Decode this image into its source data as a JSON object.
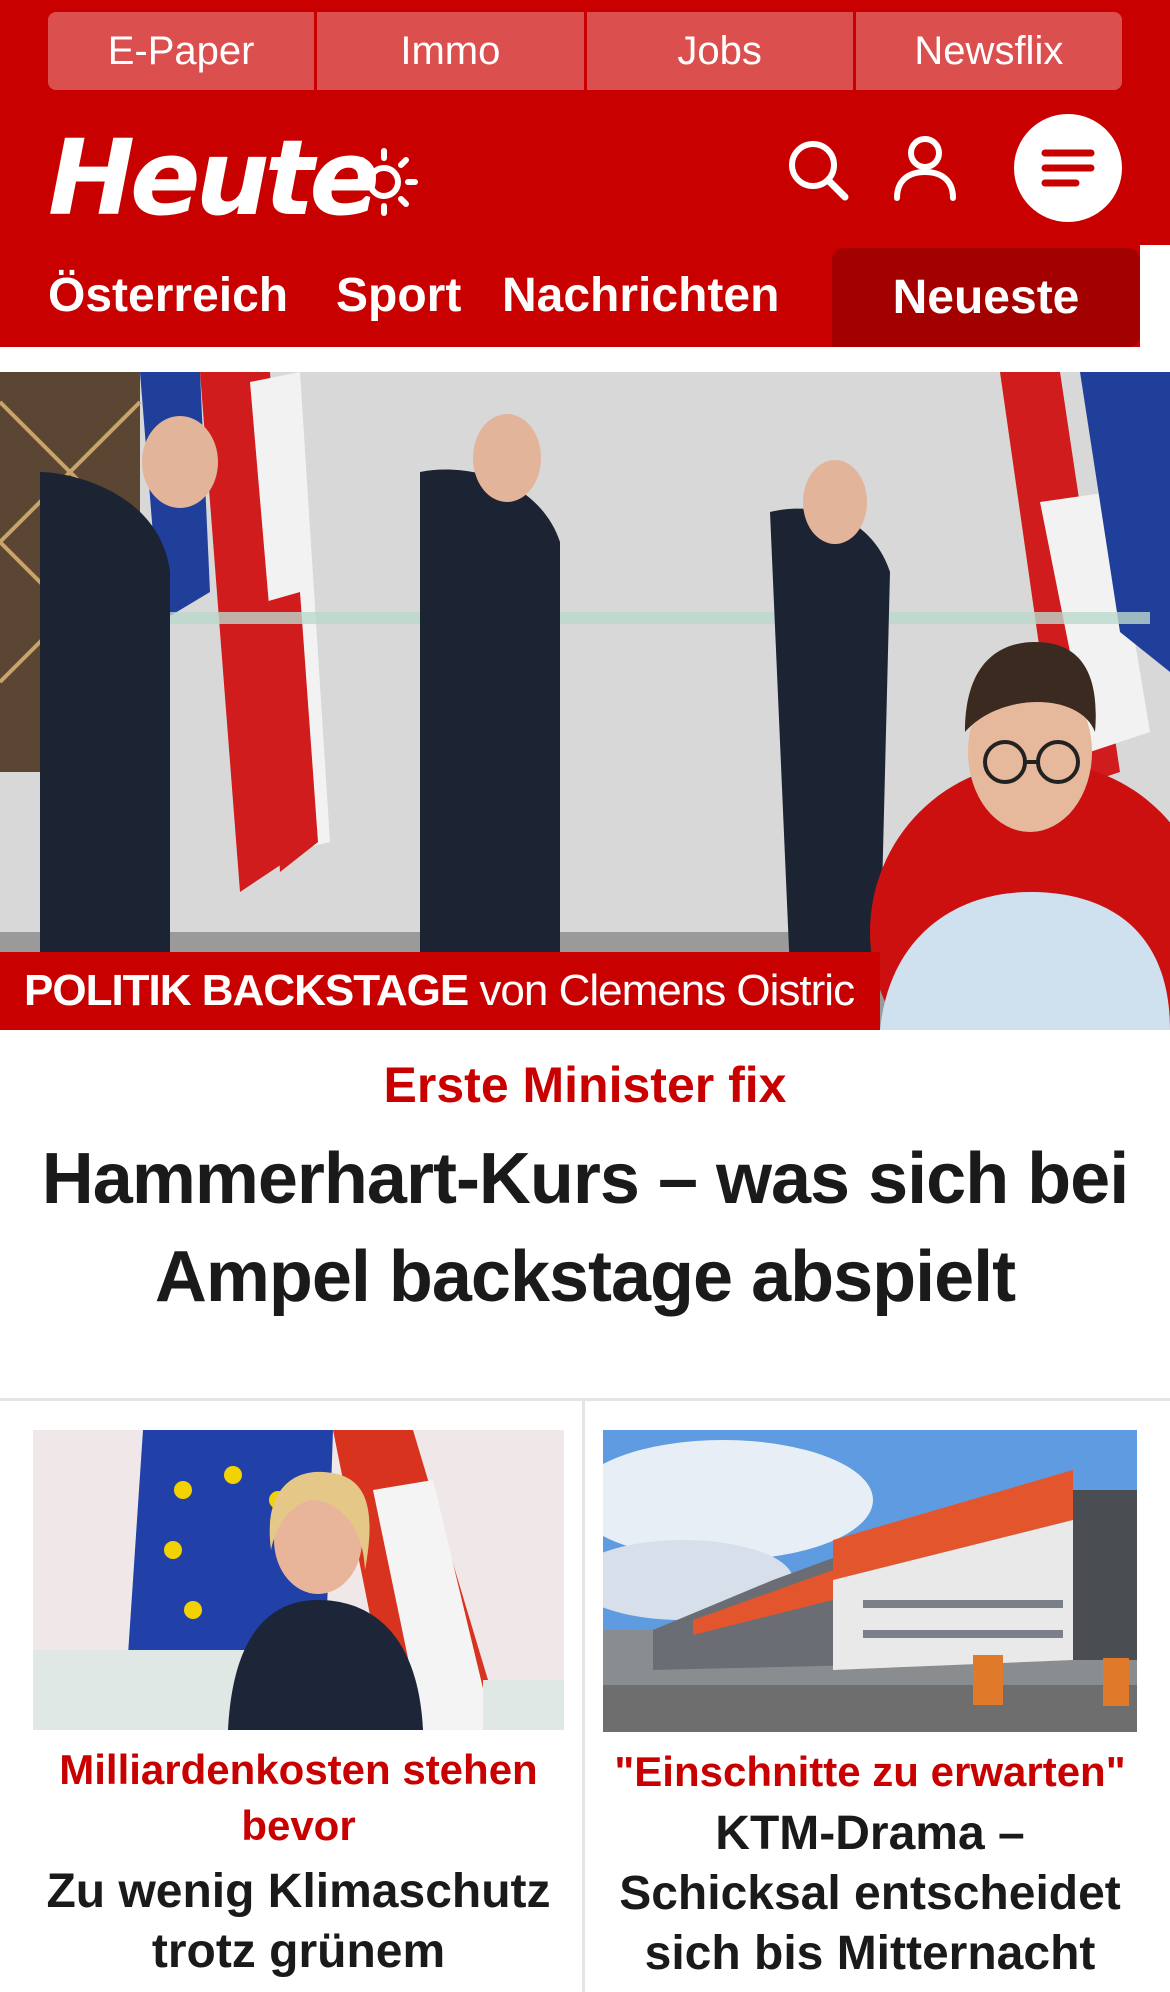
{
  "subnav": {
    "items": [
      {
        "label": "E-Paper"
      },
      {
        "label": "Immo"
      },
      {
        "label": "Jobs"
      },
      {
        "label": "Newsflix"
      }
    ]
  },
  "header": {
    "logo": "Heute",
    "icons": [
      "sun-icon",
      "search-icon",
      "user-icon",
      "menu-icon"
    ]
  },
  "mainnav": {
    "items": [
      {
        "label": "Österreich"
      },
      {
        "label": "Sport"
      },
      {
        "label": "Nachrichten"
      }
    ],
    "active": {
      "label": "Neueste"
    }
  },
  "hero": {
    "banner_bold": "POLITIK BACKSTAGE",
    "banner_rest": "von Clemens Oistric",
    "kicker": "Erste Minister fix",
    "title": "Hammerhart-Kurs – was sich bei Ampel backstage abspielt"
  },
  "cards": [
    {
      "kicker": "Milliardenkosten stehen bevor",
      "title": "Zu wenig Klimaschutz trotz grünem"
    },
    {
      "kicker": "\"Einschnitte zu erwarten\"",
      "title": "KTM-Drama – Schicksal entscheidet sich bis Mitternacht"
    }
  ],
  "colors": {
    "brand_red": "#c80000",
    "subnav_tab": "#dc4f4f",
    "active_tab": "#a30000",
    "text": "#1a1a1a",
    "divider": "#e5e5e5"
  }
}
